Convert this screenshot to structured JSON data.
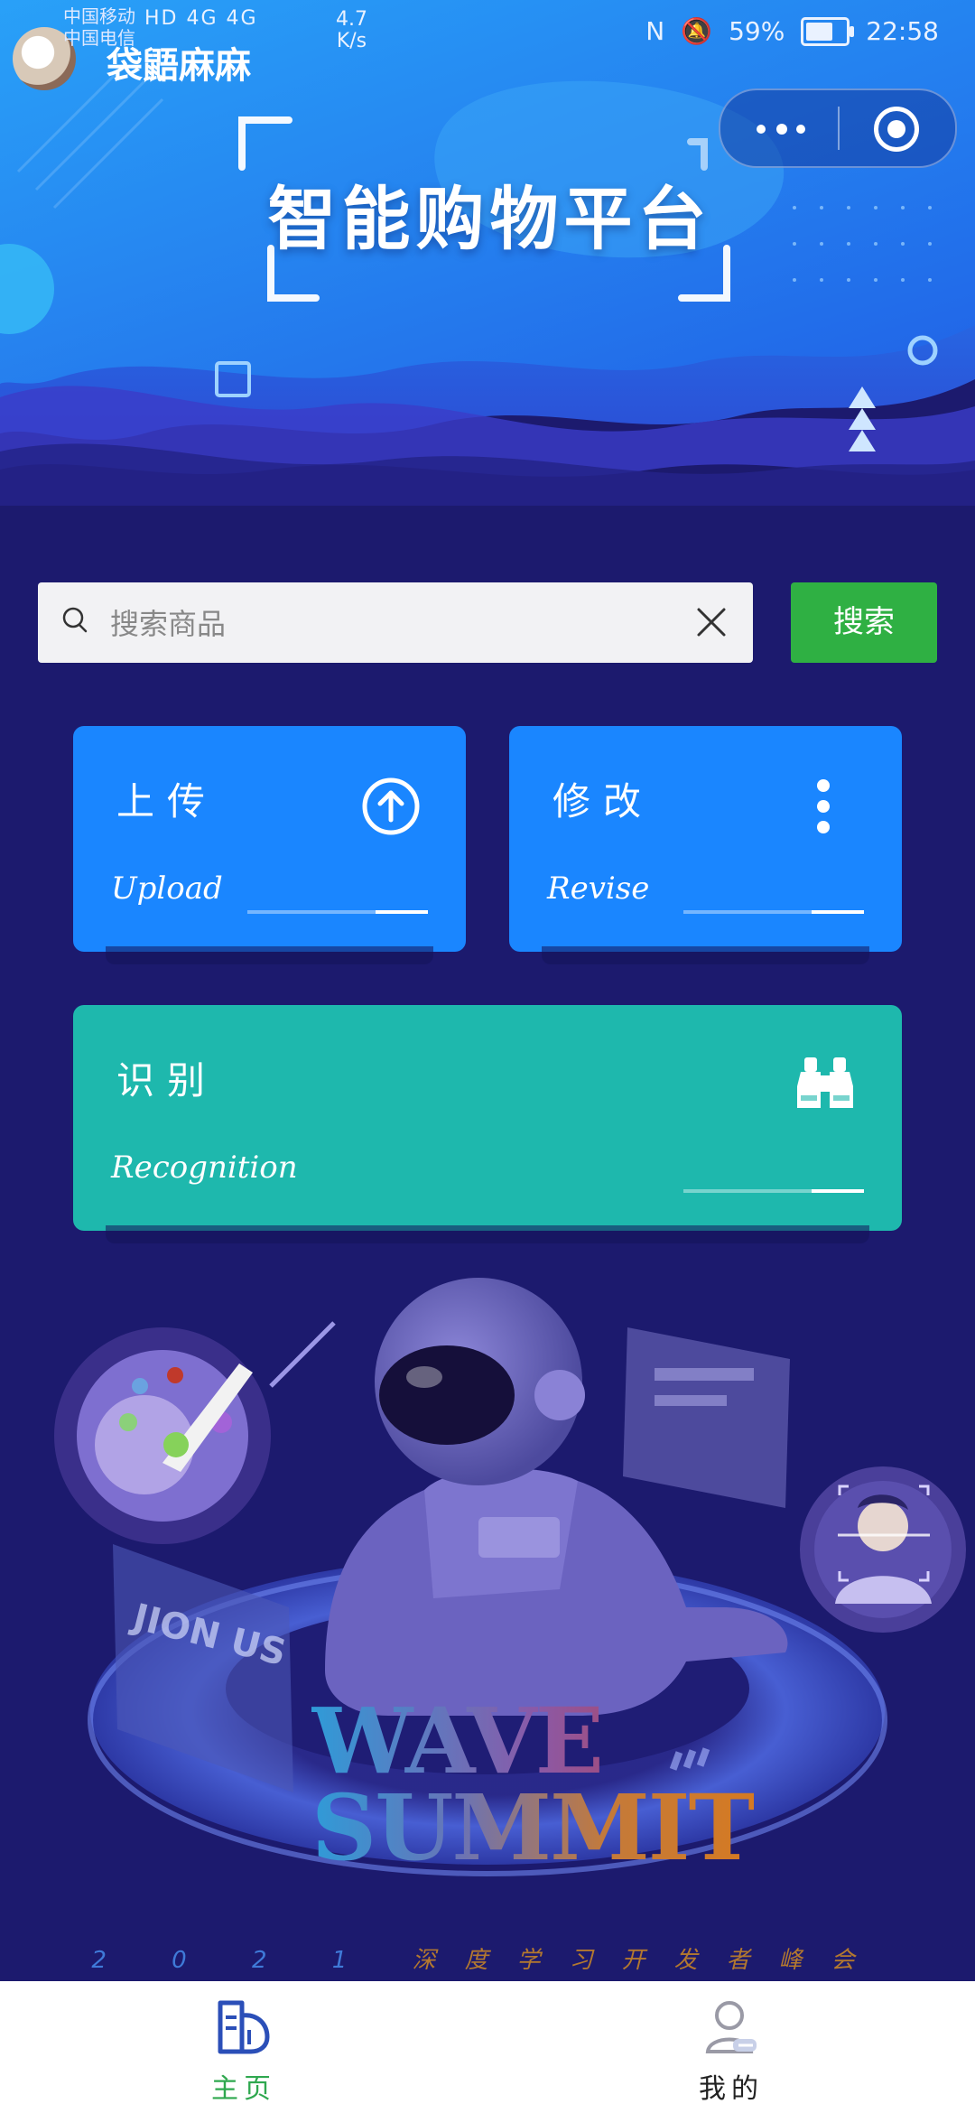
{
  "status_bar": {
    "carrier1": "中国移动",
    "carrier2": "中国电信",
    "network": "HD 4G 4G",
    "speed_value": "4.7",
    "speed_unit": "K/s",
    "battery": "59%",
    "battery_level": 0.59,
    "time": "22:58"
  },
  "app": {
    "name": "袋鼯麻麻"
  },
  "capsule": {
    "more_icon": "more-dots-icon",
    "close_icon": "target-close-icon"
  },
  "header": {
    "title": "智能购物平台"
  },
  "search": {
    "placeholder": "搜索商品",
    "button_label": "搜索"
  },
  "cards": {
    "upload": {
      "zh": "上传",
      "en": "Upload",
      "icon": "upload-arrow-icon"
    },
    "revise": {
      "zh": "修改",
      "en": "Revise",
      "icon": "vertical-dots-icon"
    },
    "recognition": {
      "zh": "识别",
      "en": "Recognition",
      "icon": "binoculars-icon"
    }
  },
  "illustration": {
    "wave_line1": "WAVE",
    "wave_line2": "SUMMIT",
    "caption_numbers": "2 0 2 1",
    "caption_text": "深度学习开发者峰会",
    "badge_text": "JION US"
  },
  "tabbar": {
    "home_label": "主页",
    "mine_label": "我的"
  },
  "colors": {
    "background": "#1c1a6e",
    "card_blue": "#1a86ff",
    "card_teal": "#1eb8ad",
    "search_green": "#2fb043",
    "tab_active": "#2fa84f"
  }
}
